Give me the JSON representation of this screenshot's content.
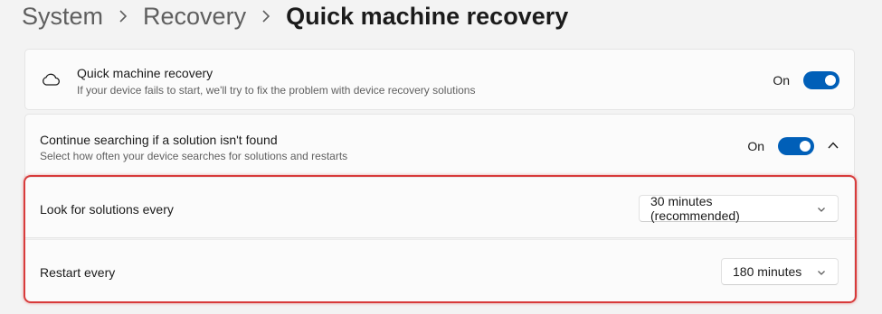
{
  "breadcrumb": {
    "items": [
      "System",
      "Recovery"
    ],
    "current": "Quick machine recovery"
  },
  "quick_recovery": {
    "icon": "cloud-icon",
    "title": "Quick machine recovery",
    "description": "If your device fails to start, we'll try to fix the problem with device recovery solutions",
    "toggle_label": "On"
  },
  "continue_search": {
    "title": "Continue searching if a solution isn't found",
    "description": "Select how often your device searches for solutions and restarts",
    "toggle_label": "On",
    "expand_icon": "chevron-up-icon"
  },
  "look_for_solutions": {
    "label": "Look for solutions every",
    "selected": "30 minutes (recommended)"
  },
  "restart_every": {
    "label": "Restart every",
    "selected": "180 minutes"
  },
  "colors": {
    "accent": "#005fb8",
    "highlight": "#d83b3b"
  }
}
